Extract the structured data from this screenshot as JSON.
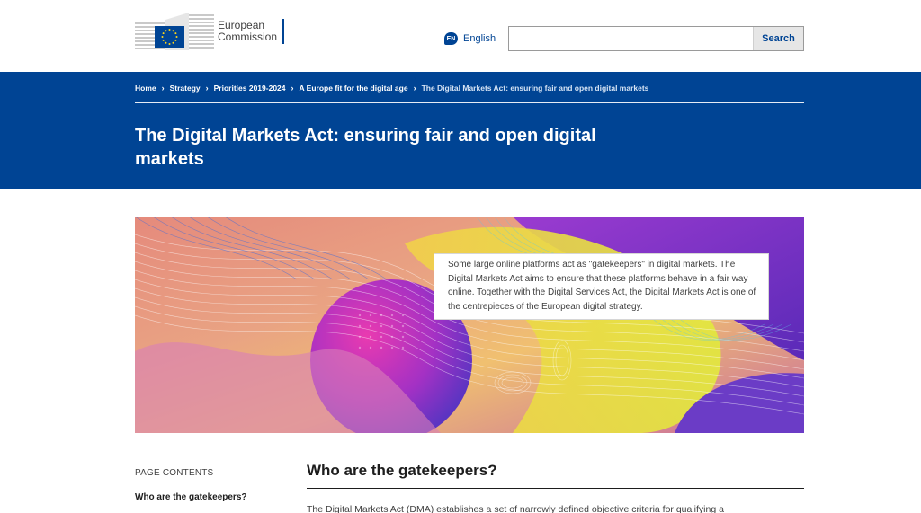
{
  "header": {
    "logo_line1": "European",
    "logo_line2": "Commission",
    "lang_code": "EN",
    "lang_label": "English",
    "search_value": "",
    "search_button": "Search"
  },
  "breadcrumb": [
    {
      "label": "Home"
    },
    {
      "label": "Strategy"
    },
    {
      "label": "Priorities 2019-2024"
    },
    {
      "label": "A Europe fit for the digital age"
    },
    {
      "label": "The Digital Markets Act: ensuring fair and open digital markets"
    }
  ],
  "page_title": "The Digital Markets Act: ensuring fair and open digital markets",
  "hero": {
    "intro": "Some large online platforms act as \"gatekeepers\" in digital markets. The Digital Markets Act aims to ensure that these platforms behave in a fair way online. Together with the Digital Services Act, the Digital Markets Act is one of the centrepieces of the European digital strategy."
  },
  "toc": {
    "heading": "PAGE CONTENTS",
    "items": [
      {
        "label": "Who are the gatekeepers?"
      }
    ]
  },
  "section": {
    "title": "Who are the gatekeepers?",
    "text_partial": "The Digital Markets Act (DMA) establishes a set of narrowly defined objective criteria for qualifying a"
  },
  "colors": {
    "brand_blue": "#004494",
    "link_blue": "#004494",
    "eu_yellow": "#ffd617"
  }
}
